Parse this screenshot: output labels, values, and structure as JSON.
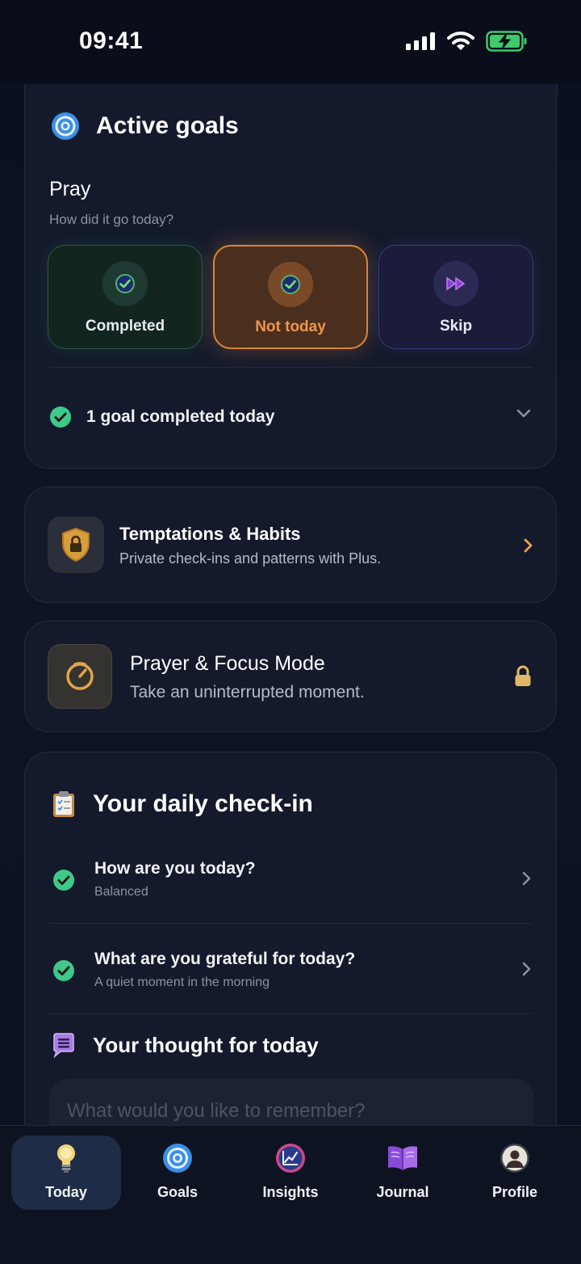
{
  "status": {
    "time": "09:41"
  },
  "active_goals": {
    "title": "Active goals",
    "goal_name": "Pray",
    "question": "How did it go today?",
    "options": [
      {
        "label": "Completed",
        "state": "default",
        "color": "#2ea064"
      },
      {
        "label": "Not today",
        "state": "selected",
        "color": "#f0954a"
      },
      {
        "label": "Skip",
        "state": "default",
        "color": "#6b5ce7"
      }
    ],
    "summary": "1 goal completed today"
  },
  "temptations": {
    "title": "Temptations & Habits",
    "subtitle": "Private check-ins and patterns with Plus."
  },
  "prayer_focus": {
    "title": "Prayer & Focus Mode",
    "subtitle": "Take an uninterrupted moment."
  },
  "daily_checkin": {
    "title": "Your daily check-in",
    "items": [
      {
        "question": "How are you today?",
        "answer": "Balanced"
      },
      {
        "question": "What are you grateful for today?",
        "answer": "A quiet moment in the morning"
      }
    ],
    "thought_title": "Your thought for today",
    "thought_placeholder": "What would you like to remember?"
  },
  "tabs": [
    {
      "label": "Today",
      "icon": "lightbulb-icon",
      "active": true
    },
    {
      "label": "Goals",
      "icon": "target-icon",
      "active": false
    },
    {
      "label": "Insights",
      "icon": "chart-icon",
      "active": false
    },
    {
      "label": "Journal",
      "icon": "book-icon",
      "active": false
    },
    {
      "label": "Profile",
      "icon": "profile-icon",
      "active": false
    }
  ],
  "colors": {
    "accent_green": "#3ec98a",
    "accent_orange": "#f0954a",
    "accent_gold": "#e0a64a",
    "background": "#0b101d"
  }
}
